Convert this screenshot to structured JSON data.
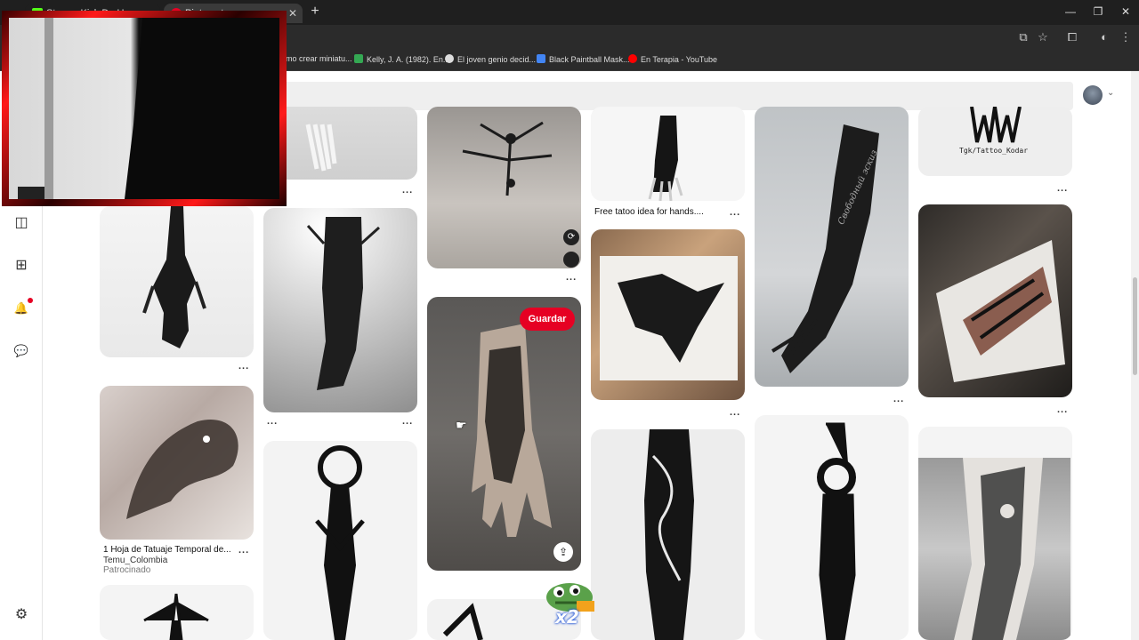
{
  "browser": {
    "tabs": [
      {
        "label": "Stream Kick De Username Chat",
        "active": false
      },
      {
        "label": "Pinterest",
        "active": true
      }
    ],
    "new_tab": "+",
    "window_controls": {
      "minimize": "—",
      "restore": "❐",
      "close": "✕"
    },
    "bookmarks": [
      {
        "label": "omo crear miniatu...",
        "color": "#555555"
      },
      {
        "label": "Kelly, J. A. (1982). En...",
        "color": "#34a853"
      },
      {
        "label": "El joven genio decid...",
        "color": "#dddddd"
      },
      {
        "label": "Black Paintball Mask...",
        "color": "#4285f4"
      },
      {
        "label": "En Terapia - YouTube",
        "color": "#ff0000"
      }
    ]
  },
  "sidebar": {
    "items": [
      {
        "name": "boards-icon",
        "glyph": "◫"
      },
      {
        "name": "create-icon",
        "glyph": "⊞"
      },
      {
        "name": "notifications-icon",
        "glyph": "🔔"
      },
      {
        "name": "messages-icon",
        "glyph": "💬"
      },
      {
        "name": "settings-icon",
        "glyph": "⚙"
      }
    ]
  },
  "pins": {
    "more": "...",
    "hands_title": "Free tatoo idea for hands....",
    "temu_title": "1 Hoja de Tatuaje Temporal de...",
    "temu_source": "Temu_Colombia",
    "temu_sponsored": "Patrocinado",
    "watermark": "Tgk/Tattoo_Kodar",
    "russian_text": "Свободный эскиз",
    "save_label": "Guardar",
    "share_icon": "⇪",
    "refresh_icon": "⟳"
  },
  "overlay": {
    "sticker_label": "x2"
  }
}
